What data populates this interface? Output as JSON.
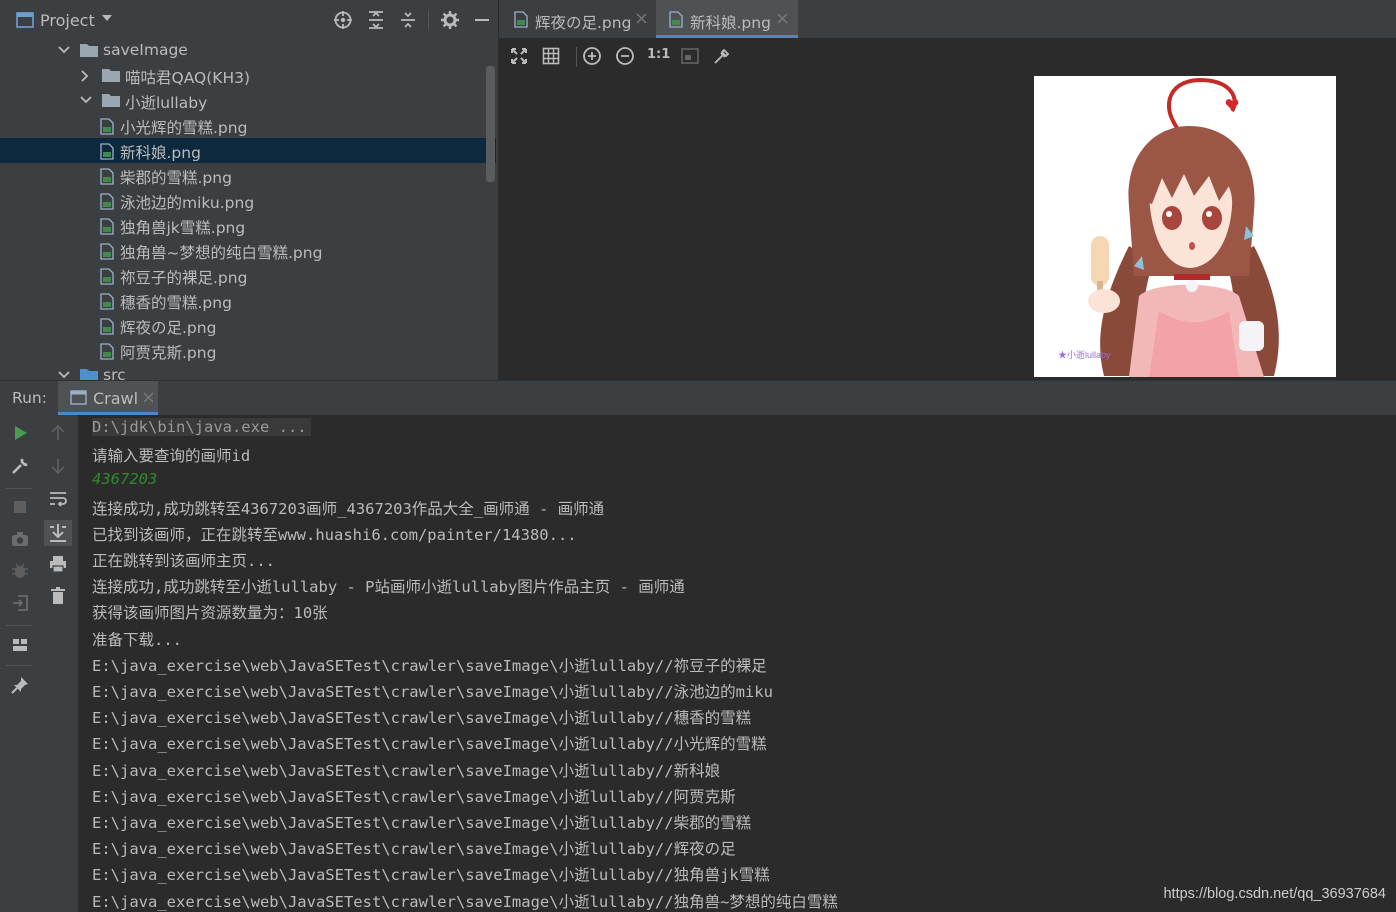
{
  "project": {
    "title": "Project",
    "tree": [
      {
        "label": "saveImage",
        "kind": "folder",
        "expanded": true,
        "depth": 0
      },
      {
        "label": "喵咕君QAQ(KH3)",
        "kind": "folder",
        "expanded": false,
        "depth": 1
      },
      {
        "label": "小逝lullaby",
        "kind": "folder",
        "expanded": true,
        "depth": 1
      },
      {
        "label": "小光辉的雪糕.png",
        "kind": "file",
        "depth": 2
      },
      {
        "label": "新科娘.png",
        "kind": "file",
        "depth": 2,
        "selected": true
      },
      {
        "label": "柴郡的雪糕.png",
        "kind": "file",
        "depth": 2
      },
      {
        "label": "泳池边的miku.png",
        "kind": "file",
        "depth": 2
      },
      {
        "label": "独角兽jk雪糕.png",
        "kind": "file",
        "depth": 2
      },
      {
        "label": "独角兽~梦想的纯白雪糕.png",
        "kind": "file",
        "depth": 2
      },
      {
        "label": "祢豆子的裸足.png",
        "kind": "file",
        "depth": 2
      },
      {
        "label": "穗香的雪糕.png",
        "kind": "file",
        "depth": 2
      },
      {
        "label": "辉夜の足.png",
        "kind": "file",
        "depth": 2
      },
      {
        "label": "阿贾克斯.png",
        "kind": "file",
        "depth": 2
      },
      {
        "label": "src",
        "kind": "folder",
        "expanded": true,
        "depth": 0
      }
    ]
  },
  "editor": {
    "tabs": [
      {
        "label": "辉夜の足.png",
        "active": false
      },
      {
        "label": "新科娘.png",
        "active": true
      }
    ],
    "toolbar": {
      "actual_size_label": "1:1"
    },
    "image_watermark": "★小逝lullaby"
  },
  "run": {
    "label": "Run:",
    "tab_label": "Crawl",
    "console": [
      {
        "text": "D:\\jdk\\bin\\java.exe ...",
        "kind": "cmd"
      },
      {
        "text": "请输入要查询的画师id",
        "kind": "out"
      },
      {
        "text": "4367203",
        "kind": "input"
      },
      {
        "text": "连接成功,成功跳转至4367203画师_4367203作品大全_画师通 - 画师通",
        "kind": "out"
      },
      {
        "text": "已找到该画师，正在跳转至www.huashi6.com/painter/14380...",
        "kind": "out"
      },
      {
        "text": "正在跳转到该画师主页...",
        "kind": "out"
      },
      {
        "text": "连接成功,成功跳转至小逝lullaby - P站画师小逝lullaby图片作品主页 - 画师通",
        "kind": "out"
      },
      {
        "text": "获得该画师图片资源数量为：10张",
        "kind": "out"
      },
      {
        "text": "准备下载...",
        "kind": "out"
      },
      {
        "text": "E:\\java_exercise\\web\\JavaSETest\\crawler\\saveImage\\小逝lullaby//祢豆子的裸足",
        "kind": "out"
      },
      {
        "text": "E:\\java_exercise\\web\\JavaSETest\\crawler\\saveImage\\小逝lullaby//泳池边的miku",
        "kind": "out"
      },
      {
        "text": "E:\\java_exercise\\web\\JavaSETest\\crawler\\saveImage\\小逝lullaby//穗香的雪糕",
        "kind": "out"
      },
      {
        "text": "E:\\java_exercise\\web\\JavaSETest\\crawler\\saveImage\\小逝lullaby//小光辉的雪糕",
        "kind": "out"
      },
      {
        "text": "E:\\java_exercise\\web\\JavaSETest\\crawler\\saveImage\\小逝lullaby//新科娘",
        "kind": "out"
      },
      {
        "text": "E:\\java_exercise\\web\\JavaSETest\\crawler\\saveImage\\小逝lullaby//阿贾克斯",
        "kind": "out"
      },
      {
        "text": "E:\\java_exercise\\web\\JavaSETest\\crawler\\saveImage\\小逝lullaby//柴郡的雪糕",
        "kind": "out"
      },
      {
        "text": "E:\\java_exercise\\web\\JavaSETest\\crawler\\saveImage\\小逝lullaby//辉夜の足",
        "kind": "out"
      },
      {
        "text": "E:\\java_exercise\\web\\JavaSETest\\crawler\\saveImage\\小逝lullaby//独角兽jk雪糕",
        "kind": "out"
      },
      {
        "text": "E:\\java_exercise\\web\\JavaSETest\\crawler\\saveImage\\小逝lullaby//独角兽~梦想的纯白雪糕",
        "kind": "out"
      }
    ]
  },
  "watermark": "https://blog.csdn.net/qq_36937684",
  "colors": {
    "background": "#2b2b2b",
    "panel": "#3c3f41",
    "selection": "#0d293e",
    "accent": "#4a88c7",
    "text": "#bbbbbb",
    "input_text": "#2e8a2e",
    "run_green": "#499c54"
  },
  "icons": {
    "project_header": [
      "project-window-icon",
      "dropdown-icon",
      "locate-icon",
      "expand-all-icon",
      "collapse-all-icon",
      "settings-gear-icon",
      "hide-minus-icon"
    ],
    "image_toolbar": [
      "fit-zoom-icon",
      "grid-icon",
      "zoom-in-icon",
      "zoom-out-icon",
      "actual-size-icon",
      "background-icon",
      "color-picker-icon"
    ],
    "run_toolbar": [
      "rerun-icon",
      "settings-wrench-icon",
      "stop-icon",
      "camera-icon",
      "debug-icon",
      "exit-icon",
      "layout-icon",
      "pin-icon",
      "up-arrow-icon",
      "down-arrow-icon",
      "soft-wrap-icon",
      "scroll-to-end-icon",
      "print-icon",
      "trash-icon"
    ]
  }
}
